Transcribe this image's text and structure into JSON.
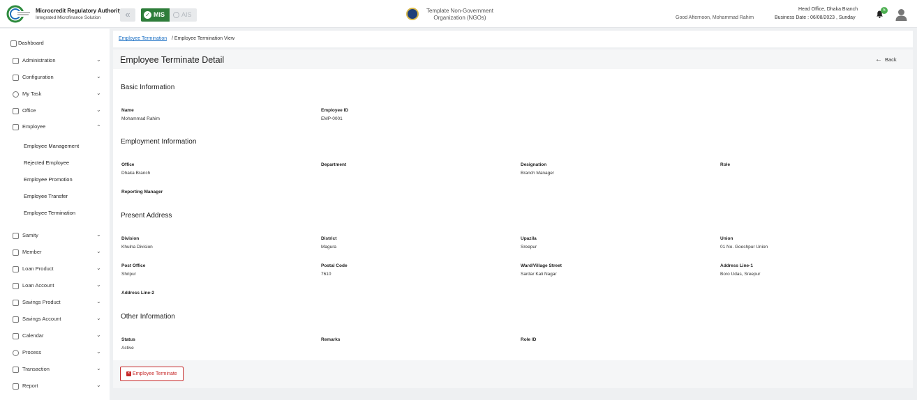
{
  "header": {
    "org_name": "Microcredit Regulatory Authority",
    "org_sub": "Integrated Microfinance Solution",
    "mode_mis": "MIS",
    "mode_ais": "AIS",
    "tenant": "Template Non-Government Organization (NGOs)",
    "greeting": "Good Afternoon, Mohammad Rahim",
    "branch": "Head Office, Dhaka Branch",
    "business_date": "Business Date : 06/08/2023 , Sunday",
    "notification_count": "5",
    "accent_color": "#2e7d3a"
  },
  "sidebar": {
    "dashboard": "Dashboard",
    "items": [
      {
        "label": "Administration"
      },
      {
        "label": "Configuration"
      },
      {
        "label": "My Task"
      },
      {
        "label": "Office"
      },
      {
        "label": "Employee"
      }
    ],
    "employee_sub": [
      {
        "label": "Employee Management"
      },
      {
        "label": "Rejected Employee"
      },
      {
        "label": "Employee Promotion"
      },
      {
        "label": "Employee Transfer"
      },
      {
        "label": "Employee Termination"
      }
    ],
    "items_after": [
      {
        "label": "Samity"
      },
      {
        "label": "Member"
      },
      {
        "label": "Loan Product"
      },
      {
        "label": "Loan Account"
      },
      {
        "label": "Savings Product"
      },
      {
        "label": "Savings Account"
      },
      {
        "label": "Calendar"
      },
      {
        "label": "Process"
      },
      {
        "label": "Transaction"
      },
      {
        "label": "Report"
      }
    ]
  },
  "breadcrumb": {
    "link": "Employee Termination",
    "current": "/ Employee Termination View"
  },
  "page": {
    "title": "Employee Terminate Detail",
    "back": "Back",
    "terminate_button": "Employee Terminate"
  },
  "basic": {
    "heading": "Basic Information",
    "name_label": "Name",
    "name_value": "Mohammad Rahim",
    "empid_label": "Employee ID",
    "empid_value": "EMP-0001"
  },
  "employment": {
    "heading": "Employment Information",
    "office_label": "Office",
    "office_value": "Dhaka Branch",
    "department_label": "Department",
    "designation_label": "Designation",
    "designation_value": "Branch Manager",
    "role_label": "Role",
    "manager_label": "Reporting Manager"
  },
  "address": {
    "heading": "Present Address",
    "division_label": "Division",
    "division_value": "Khulna Division",
    "district_label": "District",
    "district_value": "Magura",
    "upazila_label": "Upazila",
    "upazila_value": "Sreepur",
    "union_label": "Union",
    "union_value": "01 No. Goeshpur Union",
    "post_label": "Post Office",
    "post_value": "Shripur",
    "postal_label": "Postal Code",
    "postal_value": "7610",
    "ward_label": "Ward/Village Street",
    "ward_value": "Sardar Kali Nagar",
    "line1_label": "Address Line-1",
    "line1_value": "Boro Udas, Sreepur",
    "line2_label": "Address Line-2"
  },
  "other": {
    "heading": "Other Information",
    "status_label": "Status",
    "status_value": "Active",
    "remarks_label": "Remarks",
    "roleid_label": "Role ID"
  }
}
